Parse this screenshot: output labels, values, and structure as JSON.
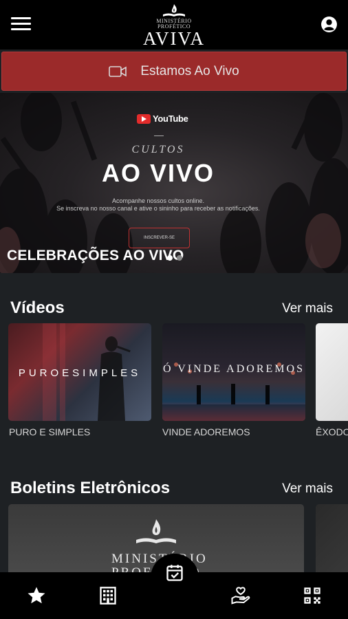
{
  "header": {
    "logo_line1": "MINISTÉRIO",
    "logo_line2": "PROFÉTICO",
    "logo_name": "AVIVA",
    "menu_icon": "hamburger-icon",
    "account_icon": "account-circle-icon"
  },
  "live_bar": {
    "label": "Estamos Ao Vivo",
    "icon": "video-camera-icon",
    "color": "#9b2a2a"
  },
  "hero": {
    "platform": "YouTube",
    "kicker": "CULTOS",
    "title": "AO VIVO",
    "sub1": "Acompanhe nossos cultos online.",
    "sub2": "Se inscreva no nosso canal e ative o sininho para receber as notificações.",
    "subscribe_label": "INSCREVER-SE",
    "caption": "CELEBRAÇÕES AO VIVO",
    "slide_count": 2,
    "active_slide": 0
  },
  "videos": {
    "title": "Vídeos",
    "see_more": "Ver mais",
    "items": [
      {
        "label": "PURO E SIMPLES",
        "art": "PUROESIMPLES"
      },
      {
        "label": "VINDE ADOREMOS",
        "art": "Ó VINDE ADOREMOS"
      },
      {
        "label": "ÊXODO"
      }
    ]
  },
  "bulletins": {
    "title": "Boletins Eletrônicos",
    "see_more": "Ver mais",
    "art_name": "MINISTÉRIO",
    "art_sub": "PROFÉTICO"
  },
  "bottom_nav": {
    "items": [
      "star-icon",
      "building-icon",
      "calendar-check-icon",
      "hand-heart-icon",
      "qr-code-icon"
    ]
  },
  "colors": {
    "background": "#1e2124",
    "bar": "#000000",
    "accent": "#9b2a2a"
  }
}
